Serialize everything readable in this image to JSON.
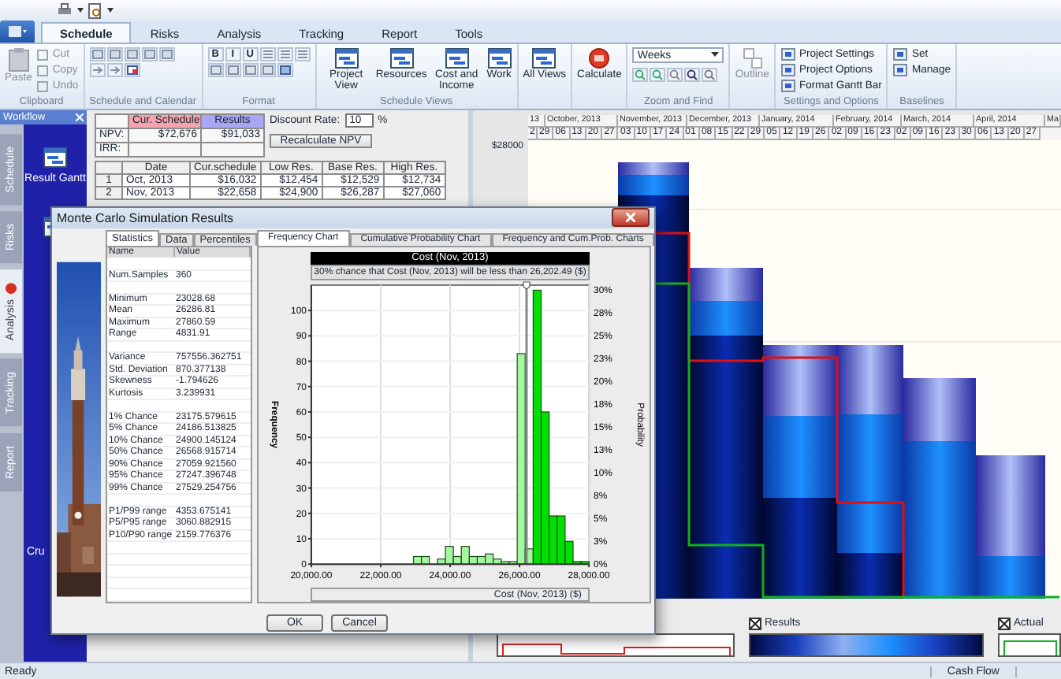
{
  "tabs": [
    {
      "label": "Schedule",
      "selected": true
    },
    {
      "label": "Risks",
      "selected": false
    },
    {
      "label": "Analysis",
      "selected": false
    },
    {
      "label": "Tracking",
      "selected": false
    },
    {
      "label": "Report",
      "selected": false
    },
    {
      "label": "Tools",
      "selected": false
    }
  ],
  "ribbon": [
    {
      "kind": "clipboard",
      "label": "Clipboard",
      "items": [
        {
          "label": "Paste",
          "disabled": true
        },
        {
          "label": "Cut",
          "disabled": true
        },
        {
          "label": "Copy",
          "disabled": true
        },
        {
          "label": "Undo",
          "disabled": true
        }
      ]
    },
    {
      "kind": "icon_grid",
      "label": "Schedule and Calendar"
    },
    {
      "kind": "format",
      "label": "Format",
      "letters": [
        "B",
        "I",
        "U"
      ]
    },
    {
      "kind": "large",
      "label": "Schedule Views",
      "items": [
        {
          "label": "Project View",
          "disabled": false
        },
        {
          "label": "Resources",
          "disabled": false
        },
        {
          "label": "Cost and Income",
          "disabled": false
        },
        {
          "label": "Work",
          "disabled": false
        }
      ]
    },
    {
      "kind": "large",
      "items": [
        {
          "label": "All Views",
          "disabled": false
        }
      ]
    },
    {
      "kind": "calculate",
      "items": [
        {
          "label": "Calculate",
          "disabled": false
        }
      ]
    },
    {
      "kind": "zoom",
      "label": "Zoom and Find",
      "value": "Weeks"
    },
    {
      "kind": "large",
      "items": [
        {
          "label": "Outline",
          "disabled": true
        }
      ]
    },
    {
      "kind": "small",
      "label": "Settings and Options",
      "items": [
        {
          "label": "Project Settings"
        },
        {
          "label": "Project Options"
        },
        {
          "label": "Format Gantt Bar"
        }
      ]
    },
    {
      "kind": "small",
      "label": "Baselines",
      "items": [
        {
          "label": "Set"
        },
        {
          "label": "Manage"
        }
      ]
    }
  ],
  "workflow": {
    "title": "Workflow",
    "tabs": [
      {
        "label": "Schedule",
        "selected": false
      },
      {
        "label": "Risks",
        "selected": false
      },
      {
        "label": "Analysis",
        "selected": true
      },
      {
        "label": "Tracking",
        "selected": false
      },
      {
        "label": "Report",
        "selected": false
      }
    ],
    "items": [
      "Result Gantt",
      "Cru"
    ]
  },
  "npv_table": {
    "columns": [
      "Cur. Schedule",
      "Results"
    ],
    "rows": [
      {
        "label": "NPV:",
        "values": [
          "$72,676",
          "$91,033"
        ]
      },
      {
        "label": "IRR:"
      }
    ]
  },
  "discount": {
    "label": "Discount Rate:",
    "value": "10",
    "unit": "%",
    "button": "Recalculate NPV"
  },
  "grid": {
    "columns": [
      "Date",
      "Cur.schedule",
      "Low Res.",
      "Base Res.",
      "High Res."
    ],
    "rows": [
      {
        "index": "1",
        "cells": [
          "Oct, 2013",
          "$16,032",
          "$12,454",
          "$12,529",
          "$12,734"
        ]
      },
      {
        "index": "2",
        "cells": [
          "Nov, 2013",
          "$22,658",
          "$24,900",
          "$26,287",
          "$27,060"
        ]
      }
    ]
  },
  "timeline": {
    "months": [
      "13",
      "October, 2013",
      "November, 2013",
      "December, 2013",
      "January, 2014",
      "February, 2014",
      "March, 2014",
      "April, 2014",
      "Ma"
    ],
    "days": [
      "2",
      "29",
      "06",
      "13",
      "20",
      "27",
      "03",
      "10",
      "17",
      "24",
      "01",
      "08",
      "15",
      "22",
      "29",
      "05",
      "12",
      "19",
      "26",
      "02",
      "09",
      "16",
      "23",
      "02",
      "09",
      "16",
      "23",
      "30",
      "06",
      "13",
      "20",
      "27"
    ]
  },
  "cash_flow": {
    "axis_label": "$28000"
  },
  "legend": [
    {
      "label": "Results",
      "checked": true
    },
    {
      "label": "Actual",
      "checked": true
    }
  ],
  "status_bar": {
    "left": "Ready",
    "right": "Cash Flow"
  },
  "dialog": {
    "title": "Monte Carlo Simulation Results",
    "stats_tabs": [
      {
        "label": "Statistics",
        "selected": true
      },
      {
        "label": "Data",
        "selected": false
      },
      {
        "label": "Percentiles",
        "selected": false
      }
    ],
    "stats_columns": [
      "Name",
      "Value"
    ],
    "stats_groups": [
      [
        {
          "name": "Num.Samples",
          "value": "360"
        }
      ],
      [
        {
          "name": "Minimum",
          "value": "23028.68"
        },
        {
          "name": "Mean",
          "value": "26286.81"
        },
        {
          "name": "Maximum",
          "value": "27860.59"
        },
        {
          "name": "Range",
          "value": "4831.91"
        }
      ],
      [
        {
          "name": "Variance",
          "value": "757556.362751"
        },
        {
          "name": "Std. Deviation",
          "value": "870.377138"
        },
        {
          "name": "Skewness",
          "value": "-1.794626"
        },
        {
          "name": "Kurtosis",
          "value": "3.239931"
        }
      ],
      [
        {
          "name": "1% Chance",
          "value": "23175.579615"
        },
        {
          "name": "5% Chance",
          "value": "24186.513825"
        },
        {
          "name": "10% Chance",
          "value": "24900.145124"
        },
        {
          "name": "50% Chance",
          "value": "26568.915714"
        },
        {
          "name": "90% Chance",
          "value": "27059.921560"
        },
        {
          "name": "95% Chance",
          "value": "27247.396748"
        },
        {
          "name": "99% Chance",
          "value": "27529.254756"
        }
      ],
      [
        {
          "name": "P1/P99 range",
          "value": "4353.675141"
        },
        {
          "name": "P5/P95 range",
          "value": "3060.882915"
        },
        {
          "name": "P10/P90 range",
          "value": "2159.776376"
        }
      ]
    ],
    "chart_tabs": [
      {
        "label": "Frequency Chart",
        "selected": true
      },
      {
        "label": "Cumulative Probability Chart",
        "selected": false
      },
      {
        "label": "Frequency and Cum.Prob. Charts",
        "selected": false
      }
    ],
    "chart_data": {
      "type": "bar",
      "title": "Cost (Nov, 2013)",
      "xlabel": "Cost (Nov, 2013) ($)",
      "ylabel": "Frequency",
      "stacked": true,
      "x": [
        23058,
        23288,
        23518,
        23748,
        23978,
        24208,
        24438,
        24668,
        24898,
        25128,
        25358,
        25588,
        25818,
        26048,
        26278,
        26508,
        26738,
        26968,
        27198,
        27428,
        27658,
        27888
      ],
      "grid": true,
      "series": [
        {
          "color": "#a6f5a0",
          "values": [
            3,
            3,
            0,
            2,
            7,
            3,
            7,
            3,
            3,
            4,
            2,
            1,
            1,
            83,
            6,
            null,
            null,
            null,
            null,
            null,
            null,
            null
          ]
        },
        {
          "color": "#00e000",
          "values": [
            null,
            null,
            null,
            null,
            null,
            null,
            null,
            null,
            null,
            null,
            null,
            null,
            null,
            null,
            null,
            108,
            60,
            19,
            19,
            9,
            1,
            1
          ]
        }
      ],
      "xlim": [
        20000,
        28000
      ],
      "ylim": [
        0,
        110
      ],
      "xticks": [
        {
          "value": 20000,
          "label": "20,000.00"
        },
        {
          "value": 22000,
          "label": "22,000.00"
        },
        {
          "value": 24000,
          "label": "24,000.00"
        },
        {
          "value": 26000,
          "label": "26,000.00"
        },
        {
          "value": 28000,
          "label": "28,000.00"
        }
      ],
      "yticks": [
        0,
        10,
        20,
        30,
        40,
        50,
        60,
        70,
        80,
        90,
        100
      ],
      "ref_lines": [
        {
          "value": 26202.49,
          "axis": "x"
        }
      ]
    },
    "chart_subtitle": "30% chance that Cost (Nov, 2013) will be less than 26,202.49 ($)",
    "probability_axis": {
      "label": "Probability",
      "ticks": [
        "30%",
        "28%",
        "25%",
        "23%",
        "20%",
        "18%",
        "15%",
        "13%",
        "10%",
        "8%",
        "5%",
        "3%",
        "0%"
      ]
    },
    "buttons": [
      "OK",
      "Cancel"
    ]
  }
}
